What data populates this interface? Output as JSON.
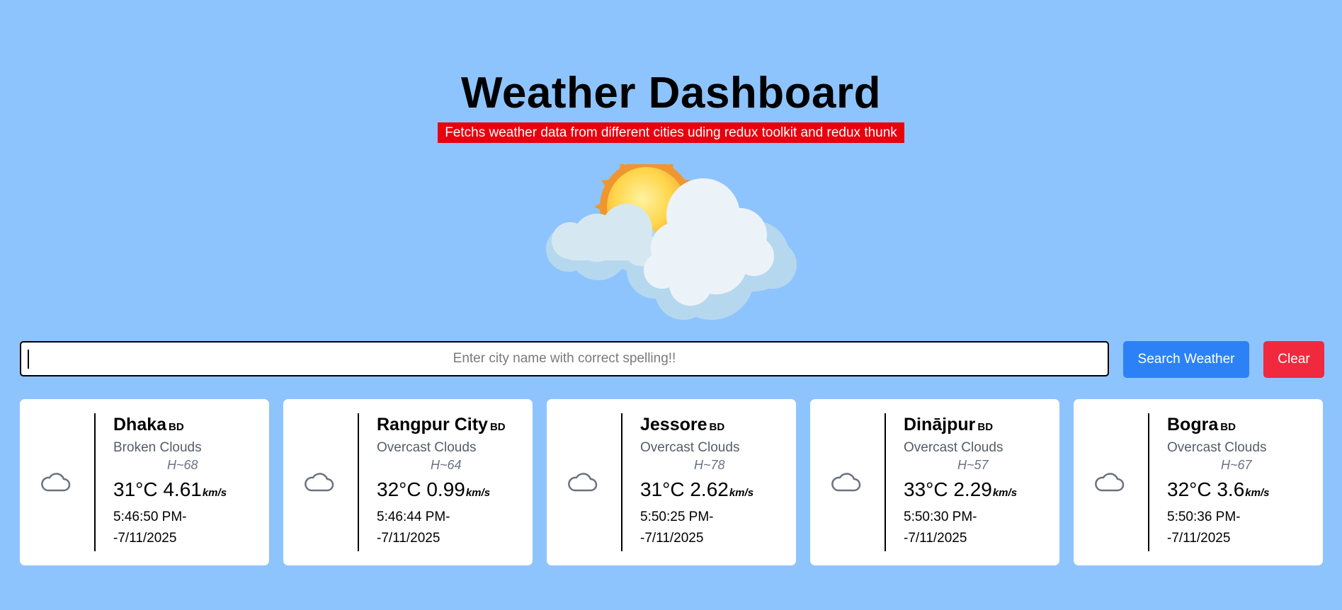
{
  "header": {
    "title": "Weather Dashboard",
    "subtitle": "Fetchs weather data from different cities uding redux toolkit and redux thunk"
  },
  "hero": {
    "icon": "sun-behind-clouds-icon"
  },
  "search": {
    "placeholder": "Enter city name with correct spelling!!",
    "value": "",
    "search_label": "Search Weather",
    "clear_label": "Clear"
  },
  "colors": {
    "background": "#8ec4fd",
    "subtitle_bg": "#e8000d",
    "search_button": "#2d81f7",
    "clear_button": "#f0293e"
  },
  "cards": [
    {
      "city": "Dhaka",
      "country": "BD",
      "description": "Broken Clouds",
      "humidity": "H~68",
      "temp": "31°C",
      "wind": "4.61",
      "wind_unit": "km/s",
      "time": "5:46:50 PM-",
      "date": "-7/11/2025",
      "icon": "cloud-icon"
    },
    {
      "city": "Rangpur City",
      "country": "BD",
      "description": "Overcast Clouds",
      "humidity": "H~64",
      "temp": "32°C",
      "wind": "0.99",
      "wind_unit": "km/s",
      "time": "5:46:44 PM-",
      "date": "-7/11/2025",
      "icon": "cloud-icon"
    },
    {
      "city": "Jessore",
      "country": "BD",
      "description": "Overcast Clouds",
      "humidity": "H~78",
      "temp": "31°C",
      "wind": "2.62",
      "wind_unit": "km/s",
      "time": "5:50:25 PM-",
      "date": "-7/11/2025",
      "icon": "cloud-icon"
    },
    {
      "city": "Dinājpur",
      "country": "BD",
      "description": "Overcast Clouds",
      "humidity": "H~57",
      "temp": "33°C",
      "wind": "2.29",
      "wind_unit": "km/s",
      "time": "5:50:30 PM-",
      "date": "-7/11/2025",
      "icon": "cloud-icon"
    },
    {
      "city": "Bogra",
      "country": "BD",
      "description": "Overcast Clouds",
      "humidity": "H~67",
      "temp": "32°C",
      "wind": "3.6",
      "wind_unit": "km/s",
      "time": "5:50:36 PM-",
      "date": "-7/11/2025",
      "icon": "cloud-icon"
    }
  ]
}
